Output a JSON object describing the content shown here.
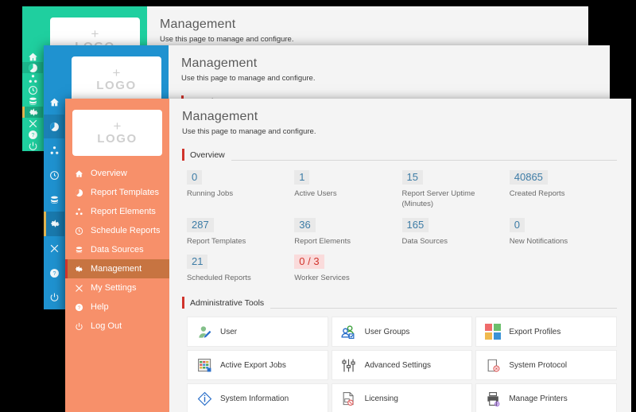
{
  "colors": {
    "teal": "#1fcf9f",
    "blue": "#1f92d0",
    "orange": "#f7906a",
    "accent_red": "#d0342c",
    "stat_number": "#3d7ca6",
    "alert_red": "#d0342c"
  },
  "logo": {
    "plus": "+",
    "word": "LOGO"
  },
  "page": {
    "title": "Management",
    "subtitle": "Use this page to manage and configure."
  },
  "sections": {
    "overview": "Overview",
    "admin_tools": "Administrative Tools"
  },
  "sidebar": {
    "items": [
      {
        "label": "Overview",
        "icon": "home-icon",
        "active": false
      },
      {
        "label": "Report Templates",
        "icon": "pie-icon",
        "active": false
      },
      {
        "label": "Report Elements",
        "icon": "nodes-icon",
        "active": false
      },
      {
        "label": "Schedule Reports",
        "icon": "clock-icon",
        "active": false
      },
      {
        "label": "Data Sources",
        "icon": "database-icon",
        "active": false
      },
      {
        "label": "Management",
        "icon": "gear-icon",
        "active": true
      },
      {
        "label": "My Settings",
        "icon": "tools-icon",
        "active": false
      },
      {
        "label": "Help",
        "icon": "help-icon",
        "active": false
      },
      {
        "label": "Log Out",
        "icon": "power-icon",
        "active": false
      }
    ]
  },
  "stats": [
    {
      "value": "0",
      "label": "Running Jobs",
      "alert": false
    },
    {
      "value": "1",
      "label": "Active Users",
      "alert": false
    },
    {
      "value": "15",
      "label": "Report Server Uptime (Minutes)",
      "alert": false
    },
    {
      "value": "40865",
      "label": "Created Reports",
      "alert": false
    },
    {
      "value": "287",
      "label": "Report Templates",
      "alert": false
    },
    {
      "value": "36",
      "label": "Report Elements",
      "alert": false
    },
    {
      "value": "165",
      "label": "Data Sources",
      "alert": false
    },
    {
      "value": "0",
      "label": "New Notifications",
      "alert": false
    },
    {
      "value": "21",
      "label": "Scheduled Reports",
      "alert": false
    },
    {
      "value": "0 / 3",
      "label": "Worker Services",
      "alert": true
    }
  ],
  "tools": [
    {
      "label": "User",
      "icon": "user-edit-icon"
    },
    {
      "label": "User Groups",
      "icon": "user-group-icon"
    },
    {
      "label": "Export Profiles",
      "icon": "color-grid-icon"
    },
    {
      "label": "Active Export Jobs",
      "icon": "spreadsheet-icon"
    },
    {
      "label": "Advanced Settings",
      "icon": "sliders-icon"
    },
    {
      "label": "System Protocol",
      "icon": "document-error-icon"
    },
    {
      "label": "System Information",
      "icon": "info-diamond-icon"
    },
    {
      "label": "Licensing",
      "icon": "license-icon"
    },
    {
      "label": "Manage Printers",
      "icon": "printer-icon"
    }
  ],
  "back_windows": {
    "first_visible_nav": "Overview"
  }
}
